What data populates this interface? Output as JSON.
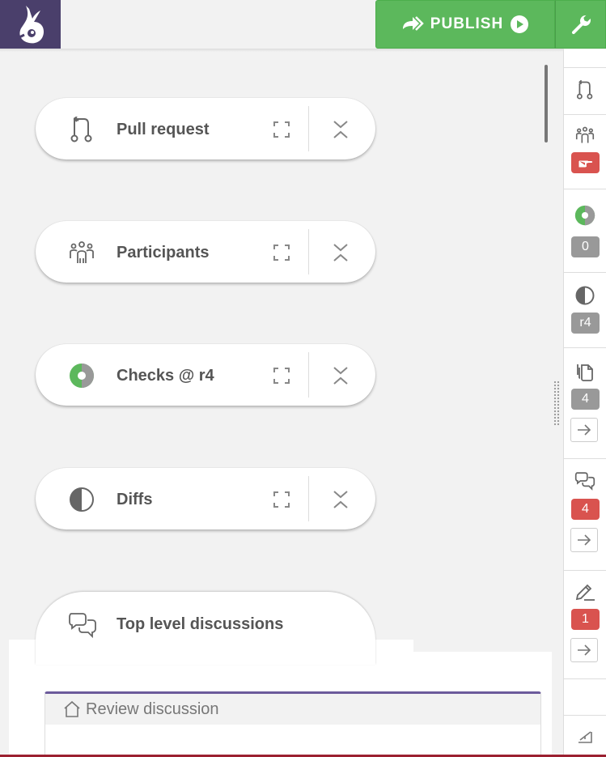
{
  "header": {
    "publish_label": "PUBLISH",
    "colors": {
      "publish": "#5cb85c",
      "logo_bg": "#4a3f6b"
    }
  },
  "cards": [
    {
      "title": "Pull request",
      "icon": "pull-request-icon"
    },
    {
      "title": "Participants",
      "icon": "participants-icon"
    },
    {
      "title": "Checks @ r4",
      "icon": "checks-icon"
    },
    {
      "title": "Diffs",
      "icon": "diffs-icon"
    }
  ],
  "open_tab": {
    "title": "Top level discussions",
    "icon": "discussions-icon"
  },
  "review": {
    "title": "Review discussion",
    "icon": "home-icon"
  },
  "sidebar": {
    "checks_badge": "0",
    "diffs_badge": "r4",
    "files_badge": "4",
    "discussions_badge": "4",
    "drafts_badge": "1"
  }
}
